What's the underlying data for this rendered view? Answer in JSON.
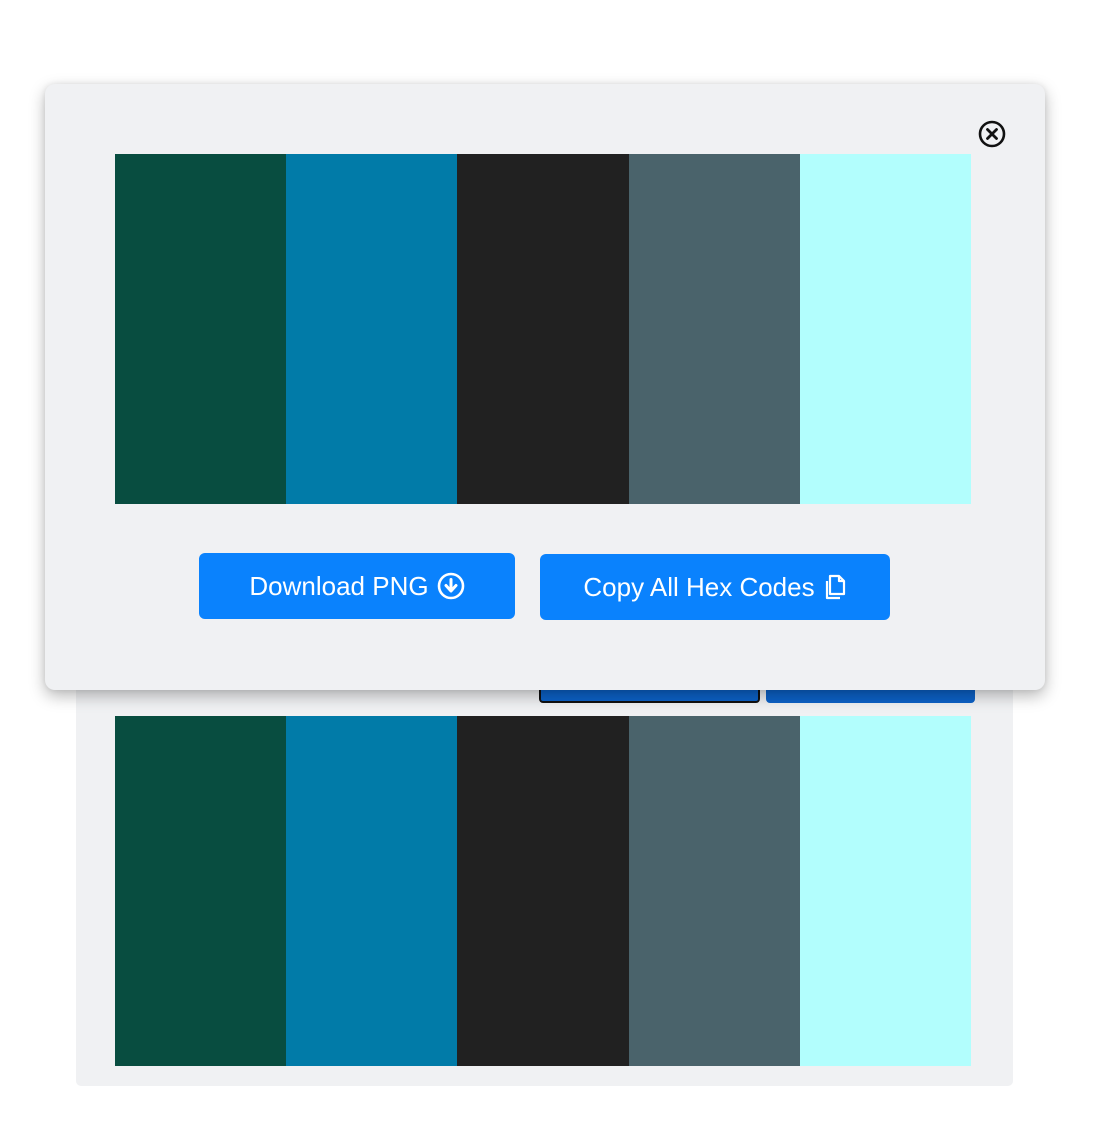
{
  "palette": {
    "colors": [
      "#084d40",
      "#017ba8",
      "#212121",
      "#4a636b",
      "#b2fefd"
    ]
  },
  "modal": {
    "close_icon": "close-circle-icon",
    "download_label": "Download PNG",
    "download_icon": "download-circle-icon",
    "copy_label": "Copy All Hex Codes",
    "copy_icon": "copy-icon"
  },
  "accent": "#0a82fd"
}
